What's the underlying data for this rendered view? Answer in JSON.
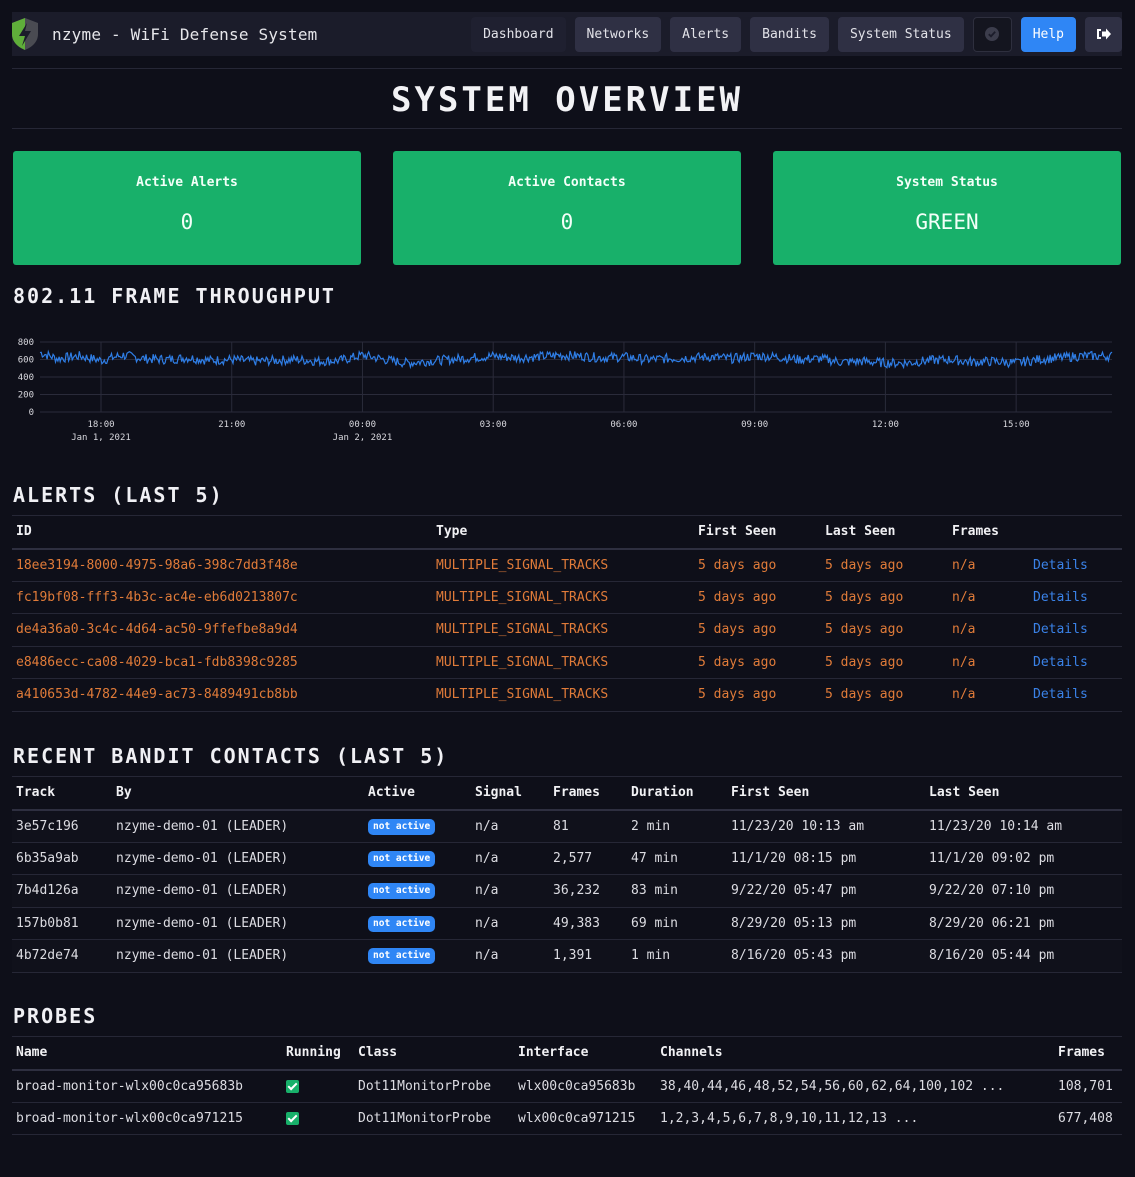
{
  "app": {
    "title": "nzyme - WiFi Defense System"
  },
  "nav": {
    "items": [
      {
        "label": "Dashboard"
      },
      {
        "label": "Networks"
      },
      {
        "label": "Alerts"
      },
      {
        "label": "Bandits"
      },
      {
        "label": "System Status"
      }
    ],
    "status_icon": "check-circle-icon",
    "help_label": "Help",
    "logout_icon": "sign-out-icon"
  },
  "page": {
    "title": "SYSTEM OVERVIEW"
  },
  "cards": [
    {
      "label": "Active Alerts",
      "value": "0"
    },
    {
      "label": "Active Contacts",
      "value": "0"
    },
    {
      "label": "System Status",
      "value": "GREEN"
    }
  ],
  "colors": {
    "card_green": "#18b06a",
    "accent_blue": "#2f86f5",
    "alert_orange": "#e07b39",
    "link_blue": "#3a82e8",
    "chart_line": "#2f7ee6"
  },
  "throughput": {
    "title": "802.11 FRAME THROUGHPUT"
  },
  "chart_data": {
    "type": "line",
    "title": "802.11 FRAME THROUGHPUT",
    "xlabel": "",
    "ylabel": "",
    "ylim": [
      0,
      800
    ],
    "yticks": [
      "0",
      "200",
      "400",
      "600",
      "800"
    ],
    "xticks": [
      {
        "label": "18:00",
        "sub": "Jan 1, 2021",
        "hour": 18
      },
      {
        "label": "21:00",
        "sub": "",
        "hour": 21
      },
      {
        "label": "00:00",
        "sub": "Jan 2, 2021",
        "hour": 24
      },
      {
        "label": "03:00",
        "sub": "",
        "hour": 27
      },
      {
        "label": "06:00",
        "sub": "",
        "hour": 30
      },
      {
        "label": "09:00",
        "sub": "",
        "hour": 33
      },
      {
        "label": "12:00",
        "sub": "",
        "hour": 36
      },
      {
        "label": "15:00",
        "sub": "",
        "hour": 39
      }
    ],
    "x_range_hours": [
      16.6,
      41.2
    ],
    "grid": true,
    "series": [
      {
        "name": "frames",
        "x_hours": [
          16.6,
          17.0,
          17.5,
          18.0,
          18.5,
          19.0,
          19.5,
          20.0,
          20.5,
          21.0,
          21.5,
          22.0,
          22.5,
          23.0,
          23.5,
          24.0,
          24.5,
          25.0,
          25.5,
          26.0,
          26.5,
          27.0,
          27.5,
          28.0,
          28.5,
          29.0,
          29.5,
          30.0,
          30.5,
          31.0,
          31.5,
          32.0,
          32.5,
          33.0,
          33.5,
          34.0,
          34.5,
          35.0,
          35.5,
          36.0,
          36.5,
          37.0,
          37.5,
          38.0,
          38.5,
          39.0,
          39.5,
          40.0,
          40.5,
          41.2
        ],
        "values": [
          680,
          610,
          640,
          590,
          650,
          610,
          600,
          620,
          590,
          600,
          580,
          590,
          600,
          580,
          590,
          650,
          600,
          560,
          580,
          600,
          620,
          640,
          620,
          630,
          650,
          640,
          620,
          630,
          600,
          610,
          620,
          630,
          610,
          640,
          630,
          600,
          610,
          570,
          580,
          560,
          560,
          590,
          600,
          570,
          580,
          560,
          600,
          620,
          640,
          640
        ]
      }
    ]
  },
  "alerts": {
    "title": "ALERTS (LAST 5)",
    "columns": [
      "ID",
      "Type",
      "First Seen",
      "Last Seen",
      "Frames",
      ""
    ],
    "rows": [
      {
        "id": "18ee3194-8000-4975-98a6-398c7dd3f48e",
        "type": "MULTIPLE_SIGNAL_TRACKS",
        "first_seen": "5 days ago",
        "last_seen": "5 days ago",
        "frames": "n/a",
        "link": "Details"
      },
      {
        "id": "fc19bf08-fff3-4b3c-ac4e-eb6d0213807c",
        "type": "MULTIPLE_SIGNAL_TRACKS",
        "first_seen": "5 days ago",
        "last_seen": "5 days ago",
        "frames": "n/a",
        "link": "Details"
      },
      {
        "id": "de4a36a0-3c4c-4d64-ac50-9ffefbe8a9d4",
        "type": "MULTIPLE_SIGNAL_TRACKS",
        "first_seen": "5 days ago",
        "last_seen": "5 days ago",
        "frames": "n/a",
        "link": "Details"
      },
      {
        "id": "e8486ecc-ca08-4029-bca1-fdb8398c9285",
        "type": "MULTIPLE_SIGNAL_TRACKS",
        "first_seen": "5 days ago",
        "last_seen": "5 days ago",
        "frames": "n/a",
        "link": "Details"
      },
      {
        "id": "a410653d-4782-44e9-ac73-8489491cb8bb",
        "type": "MULTIPLE_SIGNAL_TRACKS",
        "first_seen": "5 days ago",
        "last_seen": "5 days ago",
        "frames": "n/a",
        "link": "Details"
      }
    ]
  },
  "contacts": {
    "title": "RECENT BANDIT CONTACTS (LAST 5)",
    "columns": [
      "Track",
      "By",
      "Active",
      "Signal",
      "Frames",
      "Duration",
      "First Seen",
      "Last Seen"
    ],
    "rows": [
      {
        "track": "3e57c196",
        "by": "nzyme-demo-01 (LEADER)",
        "active": "not active",
        "signal": "n/a",
        "frames": "81",
        "duration": "2 min",
        "first_seen": "11/23/20 10:13 am",
        "last_seen": "11/23/20 10:14 am"
      },
      {
        "track": "6b35a9ab",
        "by": "nzyme-demo-01 (LEADER)",
        "active": "not active",
        "signal": "n/a",
        "frames": "2,577",
        "duration": "47 min",
        "first_seen": "11/1/20 08:15 pm",
        "last_seen": "11/1/20 09:02 pm"
      },
      {
        "track": "7b4d126a",
        "by": "nzyme-demo-01 (LEADER)",
        "active": "not active",
        "signal": "n/a",
        "frames": "36,232",
        "duration": "83 min",
        "first_seen": "9/22/20 05:47 pm",
        "last_seen": "9/22/20 07:10 pm"
      },
      {
        "track": "157b0b81",
        "by": "nzyme-demo-01 (LEADER)",
        "active": "not active",
        "signal": "n/a",
        "frames": "49,383",
        "duration": "69 min",
        "first_seen": "8/29/20 05:13 pm",
        "last_seen": "8/29/20 06:21 pm"
      },
      {
        "track": "4b72de74",
        "by": "nzyme-demo-01 (LEADER)",
        "active": "not active",
        "signal": "n/a",
        "frames": "1,391",
        "duration": "1 min",
        "first_seen": "8/16/20 05:43 pm",
        "last_seen": "8/16/20 05:44 pm"
      }
    ]
  },
  "probes": {
    "title": "PROBES",
    "columns": [
      "Name",
      "Running",
      "Class",
      "Interface",
      "Channels",
      "Frames"
    ],
    "rows": [
      {
        "name": "broad-monitor-wlx00c0ca95683b",
        "running": true,
        "class": "Dot11MonitorProbe",
        "interface": "wlx00c0ca95683b",
        "channels": "38,40,44,46,48,52,54,56,60,62,64,100,102 ...",
        "frames": "108,701"
      },
      {
        "name": "broad-monitor-wlx00c0ca971215",
        "running": true,
        "class": "Dot11MonitorProbe",
        "interface": "wlx00c0ca971215",
        "channels": "1,2,3,4,5,6,7,8,9,10,11,12,13 ...",
        "frames": "677,408"
      }
    ]
  }
}
